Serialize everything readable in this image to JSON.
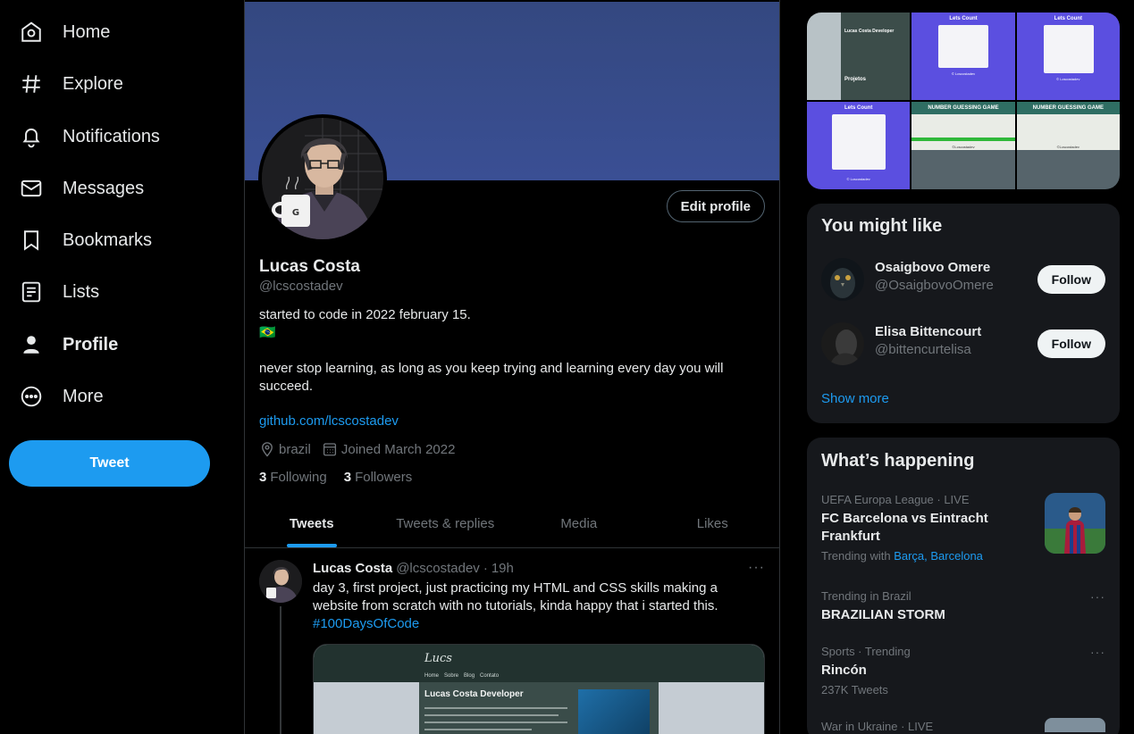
{
  "nav": {
    "home": "Home",
    "explore": "Explore",
    "notifications": "Notifications",
    "messages": "Messages",
    "bookmarks": "Bookmarks",
    "lists": "Lists",
    "profile": "Profile",
    "more": "More",
    "tweet_button": "Tweet"
  },
  "profile": {
    "name": "Lucas Costa",
    "handle": "@lcscostadev",
    "edit_button": "Edit profile",
    "bio_line1": "started to code in 2022 february 15.",
    "bio_flag": "🇧🇷",
    "bio_line2": "never stop learning, as long as you keep trying and learning every day you will succeed.",
    "link": "github.com/lcscostadev",
    "location": "brazil",
    "joined": "Joined March 2022",
    "following_count": "3",
    "following_label": "Following",
    "followers_count": "3",
    "followers_label": "Followers"
  },
  "tabs": [
    "Tweets",
    "Tweets & replies",
    "Media",
    "Likes"
  ],
  "tweet": {
    "author": "Lucas Costa",
    "handle": "@lcscostadev",
    "dot": "·",
    "time": "19h",
    "text": "day 3, first project, just practicing my HTML and CSS skills making a website from scratch with no tutorials, kinda happy that i started this.",
    "hashtag": "#100DaysOfCode",
    "more": "···",
    "media": {
      "logo": "Lucs",
      "nav": [
        "Home",
        "Sobre",
        "Blog",
        "Contato"
      ],
      "heading": "Lucas Costa Developer"
    }
  },
  "photos": {
    "cells": [
      {
        "title": "Lucas Costa Developer",
        "footer": "Projetos"
      },
      {
        "title": "Lets Count",
        "footer": "© Lcscostadev"
      },
      {
        "title": "Lets Count",
        "footer": "© Lcscostadev"
      },
      {
        "title": "Lets Count",
        "footer": "© Lcscostadev"
      },
      {
        "title": "NUMBER GUESSING GAME",
        "footer": "©Lcscostadev"
      },
      {
        "title": "NUMBER GUESSING GAME",
        "footer": "©Lcscostadev"
      }
    ]
  },
  "who_to_follow": {
    "title": "You might like",
    "users": [
      {
        "name": "Osaigbovo Omere",
        "handle": "@OsaigbovoOmere",
        "button": "Follow"
      },
      {
        "name": "Elisa Bittencourt",
        "handle": "@bittencurtelisa",
        "button": "Follow"
      }
    ],
    "show_more": "Show more"
  },
  "trends": {
    "title": "What’s happening",
    "items": [
      {
        "meta": "UEFA Europa League · LIVE",
        "title": "FC Barcelona vs Eintracht Frankfurt",
        "sub_prefix": "Trending with",
        "sub_links": "Barça, Barcelona"
      },
      {
        "meta": "Trending in Brazil",
        "title": "BRAZILIAN STORM",
        "more": "···"
      },
      {
        "meta": "Sports · Trending",
        "title": "Rincón",
        "sub": "237K Tweets",
        "more": "···"
      },
      {
        "meta": "War in Ukraine · LIVE"
      }
    ]
  },
  "colors": {
    "accent": "#1d9bf0",
    "banner": "#3a4f94",
    "background": "#000000"
  }
}
